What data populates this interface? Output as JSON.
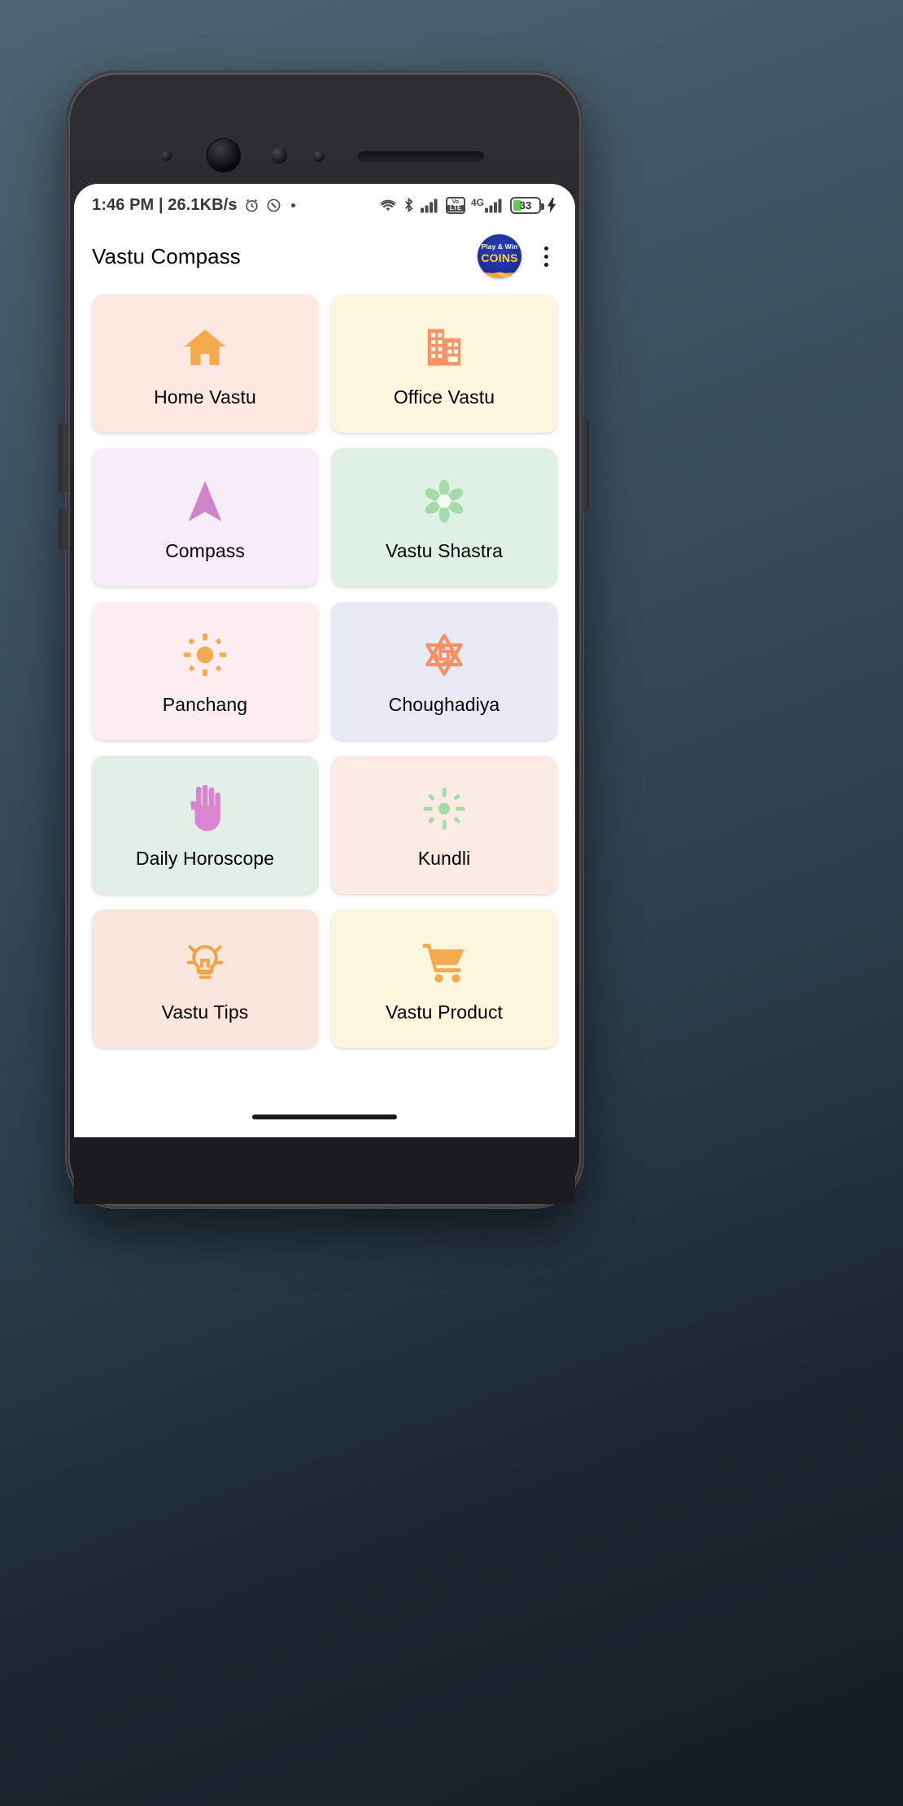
{
  "status_bar": {
    "time_and_speed": "1:46 PM | 26.1KB/s",
    "icons": [
      "alarm-icon",
      "do-not-disturb-icon",
      "dot-indicator",
      "wifi-icon",
      "bluetooth-icon",
      "signal-bars-icon",
      "volte-icon",
      "4g-icon",
      "signal-bars-2-icon",
      "battery-icon",
      "charging-bolt-icon"
    ],
    "volte_label": "Vo\nLTE",
    "volte_top": "Vo",
    "volte_bottom": "LTE",
    "network_label": "4G",
    "battery_percent": "33",
    "battery_level": 33
  },
  "app_bar": {
    "title": "Vastu Compass",
    "coins_badge": {
      "top_text": "Play & Win",
      "main_text": "COINS",
      "bg_color": "#1d2f9c",
      "text_color": "#ffd233"
    },
    "overflow_menu": "more-options"
  },
  "grid": {
    "items": [
      {
        "label": "Home Vastu",
        "icon": "home-icon",
        "bg": "#fbe8df",
        "accent": "#f4a94f"
      },
      {
        "label": "Office Vastu",
        "icon": "office-building-icon",
        "bg": "#fbf6dd",
        "accent": "#f49468"
      },
      {
        "label": "Compass",
        "icon": "navigation-arrow-icon",
        "bg": "#f7ecf7",
        "accent": "#cd84c8"
      },
      {
        "label": "Vastu Shastra",
        "icon": "flower-icon",
        "bg": "#dff0e4",
        "accent": "#a5dba8"
      },
      {
        "label": "Panchang",
        "icon": "sun-icon",
        "bg": "#fceef0",
        "accent": "#f4ab4e"
      },
      {
        "label": "Choughadiya",
        "icon": "star-swastika-icon",
        "bg": "#eaeaf6",
        "accent": "#f59062"
      },
      {
        "label": "Daily Horoscope",
        "icon": "palm-hand-icon",
        "bg": "#e2efe6",
        "accent": "#d884d1"
      },
      {
        "label": "Kundli",
        "icon": "sun-burst-icon",
        "bg": "#fceae4",
        "accent": "#a2dda5"
      },
      {
        "label": "Vastu Tips",
        "icon": "lightbulb-icon",
        "bg": "#fbe6dd",
        "accent": "#f0a448"
      },
      {
        "label": "Vastu Product",
        "icon": "shopping-cart-icon",
        "bg": "#fbf6dd",
        "accent": "#f4a94f"
      }
    ]
  },
  "nav_bar": {
    "gesture_pill": "home-gesture-pill"
  }
}
